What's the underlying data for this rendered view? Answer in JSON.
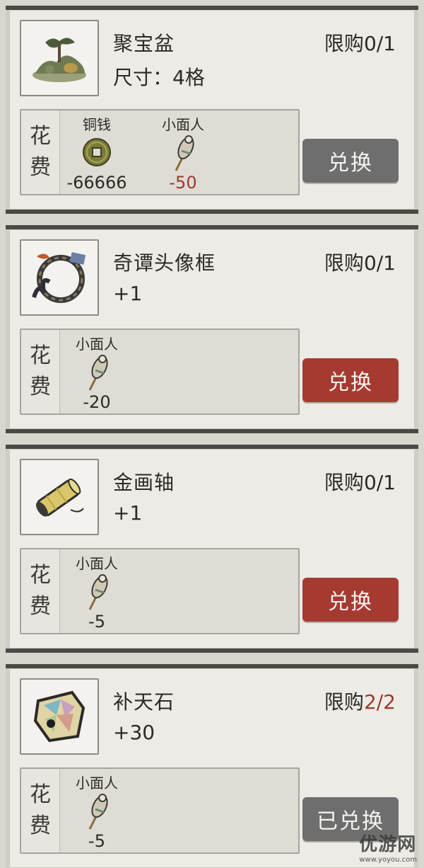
{
  "items": [
    {
      "name": "聚宝盆",
      "detail": "尺寸：4格",
      "limit_prefix": "限购",
      "limit_value": "0/1",
      "limit_color": "#2b2a27",
      "cost_label_top": "花",
      "cost_label_bottom": "费",
      "costs": [
        {
          "name": "铜钱",
          "amount": "-66666",
          "icon": "copper-coin-icon",
          "color": "#2b2a27"
        },
        {
          "name": "小面人",
          "amount": "-50",
          "icon": "dough-figurine-icon",
          "color": "#9c3a2c"
        }
      ],
      "button": "兑换",
      "button_state": "disabled",
      "button_color": "#6e6e6e",
      "thumb_icon": "treasure-bowl-icon"
    },
    {
      "name": "奇谭头像框",
      "detail": "+1",
      "limit_prefix": "限购",
      "limit_value": "0/1",
      "limit_color": "#2b2a27",
      "cost_label_top": "花",
      "cost_label_bottom": "费",
      "costs": [
        {
          "name": "小面人",
          "amount": "-20",
          "icon": "dough-figurine-icon",
          "color": "#2b2a27"
        }
      ],
      "button": "兑换",
      "button_state": "active",
      "button_color": "#a63a30",
      "thumb_icon": "avatar-frame-icon"
    },
    {
      "name": "金画轴",
      "detail": "+1",
      "limit_prefix": "限购",
      "limit_value": "0/1",
      "limit_color": "#2b2a27",
      "cost_label_top": "花",
      "cost_label_bottom": "费",
      "costs": [
        {
          "name": "小面人",
          "amount": "-5",
          "icon": "dough-figurine-icon",
          "color": "#2b2a27"
        }
      ],
      "button": "兑换",
      "button_state": "active",
      "button_color": "#a63a30",
      "thumb_icon": "golden-scroll-icon"
    },
    {
      "name": "补天石",
      "detail": "+30",
      "limit_prefix": "限购",
      "limit_value": "2/2",
      "limit_color": "#9c3a2c",
      "cost_label_top": "花",
      "cost_label_bottom": "费",
      "costs": [
        {
          "name": "小面人",
          "amount": "-5",
          "icon": "dough-figurine-icon",
          "color": "#2b2a27"
        }
      ],
      "button": "已兑换",
      "button_state": "redeemed",
      "button_color": "#6e6e6e",
      "thumb_icon": "mending-stone-icon"
    }
  ],
  "watermark": {
    "text": "优游网",
    "sub": "www.yoyou.com"
  }
}
